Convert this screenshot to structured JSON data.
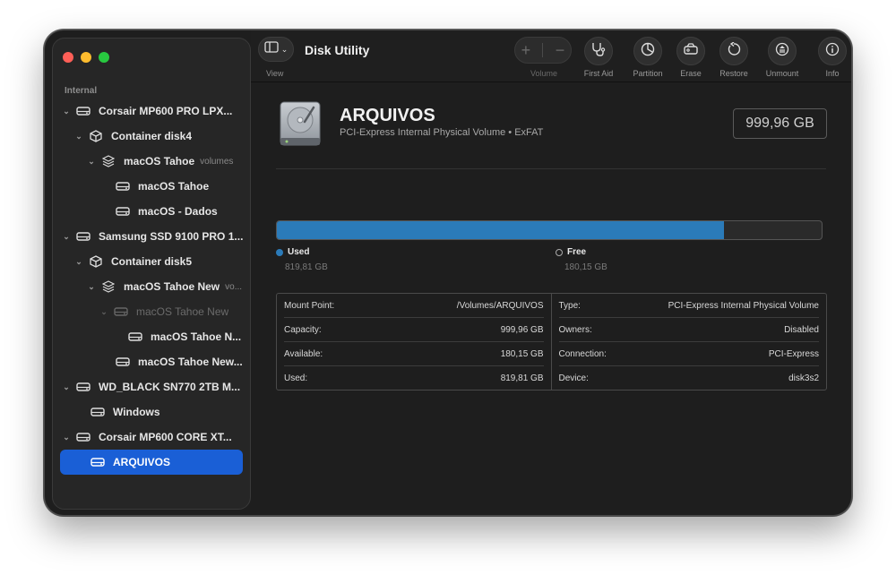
{
  "app": {
    "title": "Disk Utility"
  },
  "toolbar": {
    "view_label": "View",
    "volume_label": "Volume",
    "first_aid_label": "First Aid",
    "partition_label": "Partition",
    "erase_label": "Erase",
    "restore_label": "Restore",
    "unmount_label": "Unmount",
    "info_label": "Info",
    "plus": "+",
    "minus": "−"
  },
  "sidebar": {
    "section": "Internal",
    "items": [
      {
        "label": "Corsair MP600 PRO LPX...",
        "sub": ""
      },
      {
        "label": "Container disk4",
        "sub": ""
      },
      {
        "label": "macOS Tahoe",
        "sub": "volumes"
      },
      {
        "label": "macOS Tahoe",
        "sub": ""
      },
      {
        "label": "macOS - Dados",
        "sub": ""
      },
      {
        "label": "Samsung SSD 9100 PRO 1...",
        "sub": ""
      },
      {
        "label": "Container disk5",
        "sub": ""
      },
      {
        "label": "macOS Tahoe New",
        "sub": "vo..."
      },
      {
        "label": "macOS Tahoe New",
        "sub": ""
      },
      {
        "label": "macOS Tahoe N...",
        "sub": ""
      },
      {
        "label": "macOS Tahoe New...",
        "sub": ""
      },
      {
        "label": "WD_BLACK SN770 2TB M...",
        "sub": ""
      },
      {
        "label": "Windows",
        "sub": ""
      },
      {
        "label": "Corsair MP600 CORE XT...",
        "sub": ""
      },
      {
        "label": "ARQUIVOS",
        "sub": ""
      }
    ]
  },
  "volume": {
    "name": "ARQUIVOS",
    "description": "PCI-Express Internal Physical Volume • ExFAT",
    "size": "999,96 GB",
    "used_fraction": 0.82,
    "used_label": "Used",
    "used_value": "819,81 GB",
    "free_label": "Free",
    "free_value": "180,15 GB"
  },
  "details": {
    "left": [
      {
        "key": "Mount Point:",
        "value": "/Volumes/ARQUIVOS"
      },
      {
        "key": "Capacity:",
        "value": "999,96 GB"
      },
      {
        "key": "Available:",
        "value": "180,15 GB"
      },
      {
        "key": "Used:",
        "value": "819,81 GB"
      }
    ],
    "right": [
      {
        "key": "Type:",
        "value": "PCI-Express Internal Physical Volume"
      },
      {
        "key": "Owners:",
        "value": "Disabled"
      },
      {
        "key": "Connection:",
        "value": "PCI-Express"
      },
      {
        "key": "Device:",
        "value": "disk3s2"
      }
    ]
  },
  "colors": {
    "accent": "#1a5fd6",
    "used_bar": "#2b7bb9"
  }
}
